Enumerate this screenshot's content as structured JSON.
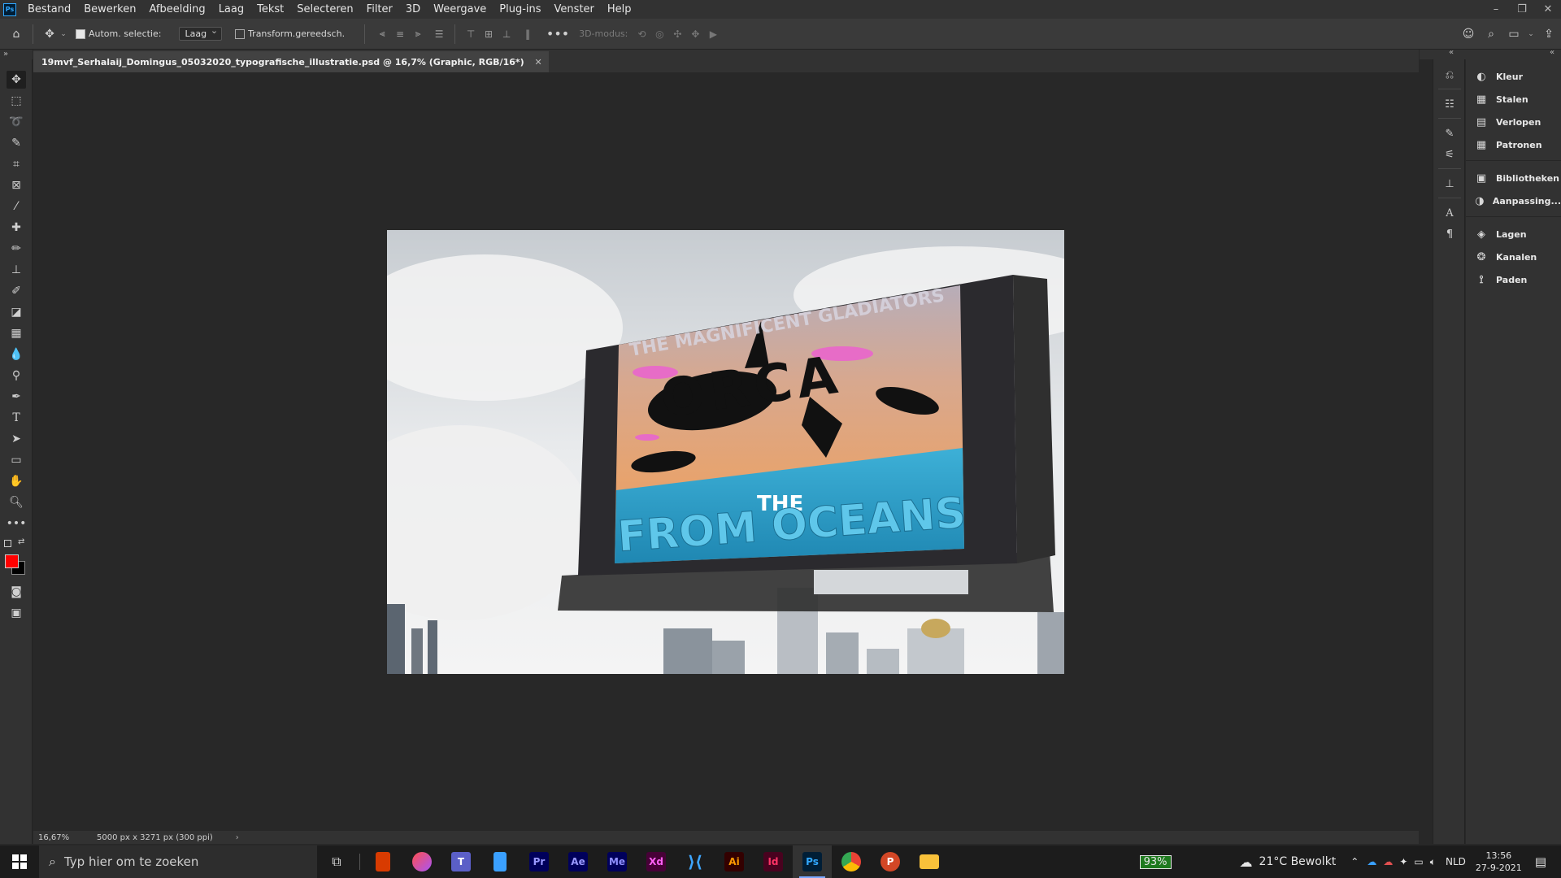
{
  "menu": {
    "app_icon": "Ps",
    "items": [
      "Bestand",
      "Bewerken",
      "Afbeelding",
      "Laag",
      "Tekst",
      "Selecteren",
      "Filter",
      "3D",
      "Weergave",
      "Plug-ins",
      "Venster",
      "Help"
    ]
  },
  "options": {
    "auto_select_label": "Autom. selectie:",
    "auto_select_checked": true,
    "layer_select_value": "Laag",
    "transform_label": "Transform.gereedsch.",
    "transform_checked": false,
    "mode_3d_label": "3D-modus:"
  },
  "document": {
    "tab_title": "19mvf_Serhalaij_Domingus_05032020_typografische_illustratie.psd @ 16,7% (Graphic, RGB/16*)",
    "billboard_top_text": "THE MAGNIFICENT GLADIATORS",
    "billboard_headline": "ORCA",
    "billboard_the": "THE",
    "billboard_bottom_text": "FROM OCEANS"
  },
  "status": {
    "zoom": "16,67%",
    "doc_info": "5000 px x 3271 px (300 ppi)"
  },
  "panels": [
    {
      "label": "Kleur",
      "icon": "color-wheel-icon"
    },
    {
      "label": "Stalen",
      "icon": "swatches-grid-icon"
    },
    {
      "label": "Verlopen",
      "icon": "gradient-icon"
    },
    {
      "label": "Patronen",
      "icon": "patterns-icon"
    },
    {
      "label": "Bibliotheken",
      "icon": "libraries-icon"
    },
    {
      "label": "Aanpassing...",
      "icon": "adjustments-icon"
    },
    {
      "label": "Lagen",
      "icon": "layers-icon"
    },
    {
      "label": "Kanalen",
      "icon": "channels-icon"
    },
    {
      "label": "Paden",
      "icon": "paths-icon"
    }
  ],
  "colors": {
    "foreground": "#ff0000",
    "background": "#000000",
    "accent_blue": "#31a8ff"
  },
  "taskbar": {
    "search_placeholder": "Typ hier om te zoeken",
    "apps": [
      "Pr",
      "Ae",
      "Me",
      "Xd",
      "Ai",
      "Id",
      "Ps"
    ],
    "battery": "93%",
    "weather": "21°C  Bewolkt",
    "language": "NLD",
    "time": "13:56",
    "date": "27-9-2021"
  }
}
